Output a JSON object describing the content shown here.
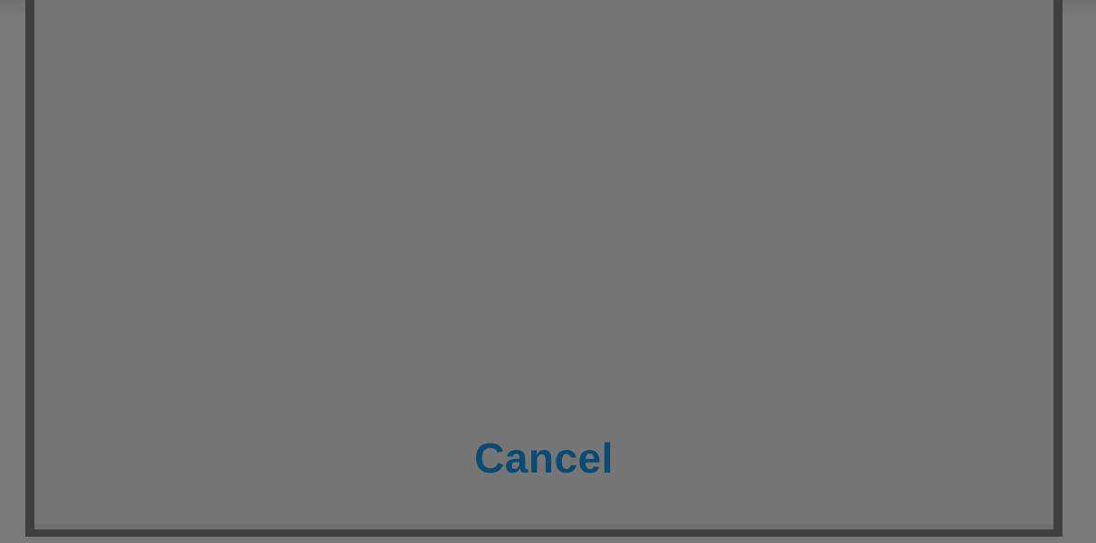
{
  "dialog": {
    "cancel_label": "Cancel",
    "cancel_color": "#0d4a72",
    "overlay_color": "#777777",
    "dialog_color": "#757575",
    "border_color": "#3f3f3f"
  }
}
